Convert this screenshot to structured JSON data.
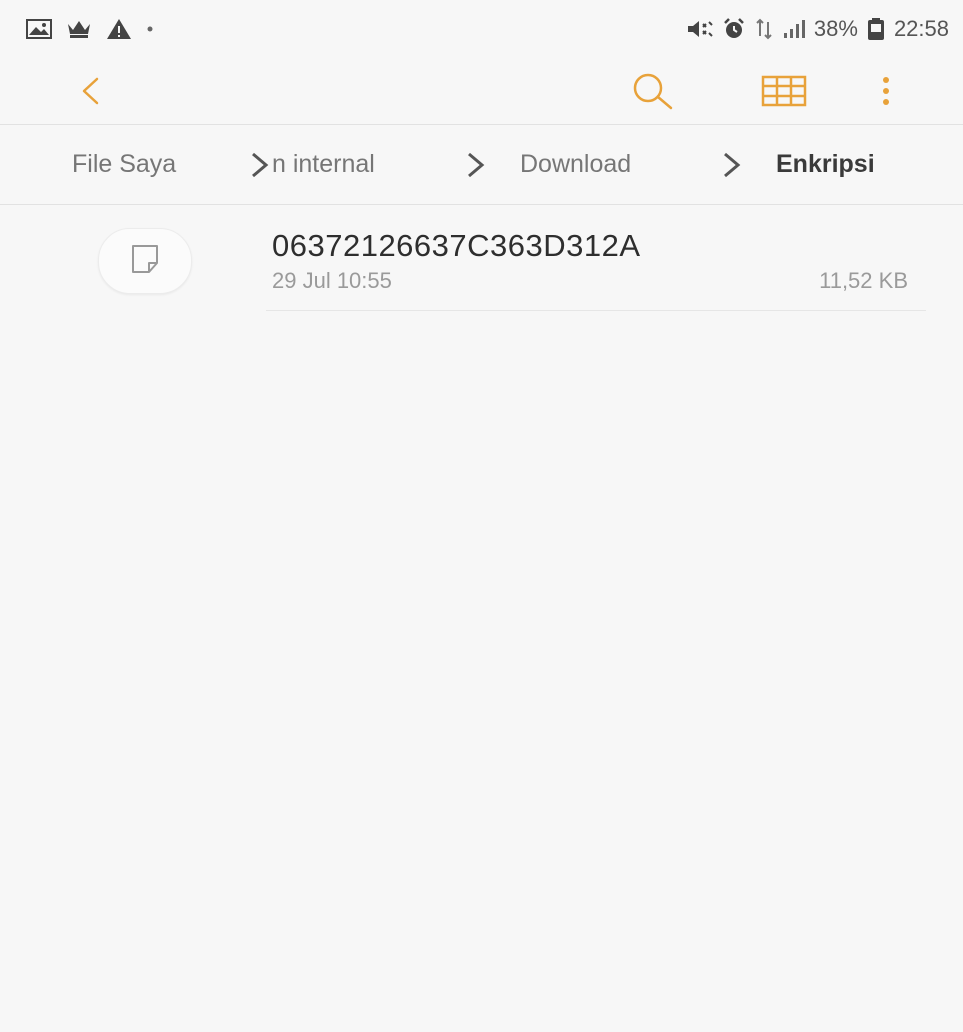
{
  "status_bar": {
    "left_icons": [
      "gallery-icon",
      "crown-icon",
      "warning-icon",
      "dot-icon"
    ],
    "right_icons": [
      "mute-vibrate-icon",
      "alarm-icon",
      "data-transfer-icon",
      "signal-icon",
      "battery-icon"
    ],
    "battery": "38%",
    "time": "22:58"
  },
  "toolbar": {
    "back_icon": "chevron-left-icon",
    "search_icon": "search-icon",
    "view_icon": "grid-view-icon",
    "more_icon": "more-vert-icon",
    "accent_color": "#e8a23a"
  },
  "breadcrumb": {
    "items": [
      {
        "label": "File Saya"
      },
      {
        "label": "n internal"
      },
      {
        "label": "Download"
      },
      {
        "label": "Enkripsi"
      }
    ]
  },
  "files": [
    {
      "name": "06372126637C363D312A",
      "date": "29 Jul 10:55",
      "size": "11,52 KB",
      "icon": "file-icon"
    }
  ]
}
